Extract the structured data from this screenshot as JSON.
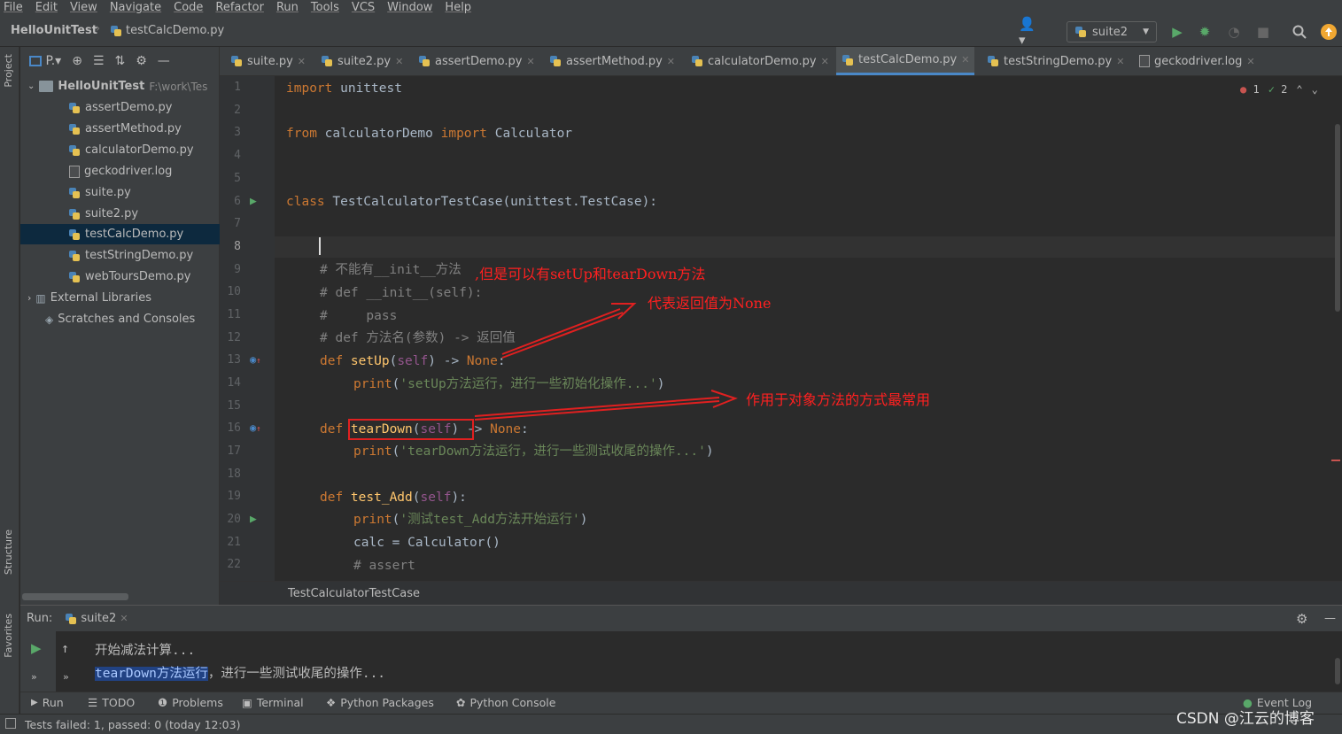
{
  "menu": [
    "File",
    "Edit",
    "View",
    "Navigate",
    "Code",
    "Refactor",
    "Run",
    "Tools",
    "VCS",
    "Window",
    "Help"
  ],
  "breadcrumb": {
    "project": "HelloUnitTest",
    "file": "testCalcDemo.py"
  },
  "run_config": "suite2",
  "left_stripe": {
    "project": "Project",
    "structure": "Structure",
    "favorites": "Favorites"
  },
  "project": {
    "toolbar_label": "P.▾",
    "root": {
      "name": "HelloUnitTest",
      "path": "F:\\work\\Tes"
    },
    "files": [
      "assertDemo.py",
      "assertMethod.py",
      "calculatorDemo.py",
      "geckodriver.log",
      "suite.py",
      "suite2.py",
      "testCalcDemo.py",
      "testStringDemo.py",
      "webToursDemo.py"
    ],
    "external": "External Libraries",
    "scratches": "Scratches and Consoles"
  },
  "tabs": [
    "suite.py",
    "suite2.py",
    "assertDemo.py",
    "assertMethod.py",
    "calculatorDemo.py",
    "testCalcDemo.py",
    "testStringDemo.py",
    "geckodriver.log"
  ],
  "editor": {
    "line_numbers": [
      "1",
      "2",
      "3",
      "4",
      "5",
      "6",
      "7",
      "8",
      "9",
      "10",
      "11",
      "12",
      "13",
      "14",
      "15",
      "16",
      "17",
      "18",
      "19",
      "20",
      "21",
      "22"
    ],
    "inspection": {
      "errors": "1",
      "warnings": "2"
    },
    "code": {
      "l1_kw": "import",
      "l1_rest": " unittest",
      "l3_kw1": "from",
      "l3_mid": " calculatorDemo ",
      "l3_kw2": "import",
      "l3_rest": " Calculator",
      "l6_kw": "class",
      "l6_rest": " TestCalculatorTestCase(unittest.TestCase):",
      "l9": "# 不能有__init__方法",
      "l10": "# def __init__(self):",
      "l11": "#     pass",
      "l12": "# def 方法名(参数) -> 返回值",
      "l13_kw": "def",
      "l13_fn": " setUp",
      "l13_p1": "(",
      "l13_self": "self",
      "l13_p2": ") -> ",
      "l13_none": "None",
      "l13_end": ":",
      "l14_fn": "print",
      "l14_p1": "(",
      "l14_str": "'setUp方法运行，进行一些初始化操作...'",
      "l14_p2": ")",
      "l16_kw": "def",
      "l16_fn": " tearDown",
      "l16_p1": "(",
      "l16_self": "self",
      "l16_p2": ") -> ",
      "l16_none": "None",
      "l16_end": ":",
      "l17_fn": "print",
      "l17_p1": "(",
      "l17_str": "'tearDown方法运行，进行一些测试收尾的操作...'",
      "l17_p2": ")",
      "l19_kw": "def",
      "l19_fn": " test_Add",
      "l19_p1": "(",
      "l19_self": "self",
      "l19_p2": "):",
      "l20_fn": "print",
      "l20_p1": "(",
      "l20_str": "'测试test_Add方法开始运行'",
      "l20_p2": ")",
      "l21": "calc = Calculator()",
      "l22": "# assert"
    },
    "crumb": "TestCalculatorTestCase"
  },
  "annotations": {
    "a1": ",但是可以有setUp和tearDown方法",
    "a2": "代表返回值为None",
    "a3": "作用于对象方法的方式最常用"
  },
  "run_panel": {
    "label": "Run:",
    "tab": "suite2",
    "line1": "开始减法计算...",
    "line2_hl": "tearDown方法运行",
    "line2_rest": "，进行一些测试收尾的操作..."
  },
  "bottom_tools": [
    "Run",
    "TODO",
    "Problems",
    "Terminal",
    "Python Packages",
    "Python Console",
    "Event Log"
  ],
  "status": "Tests failed: 1, passed: 0 (today 12:03)",
  "watermark": "CSDN @江云的博客"
}
